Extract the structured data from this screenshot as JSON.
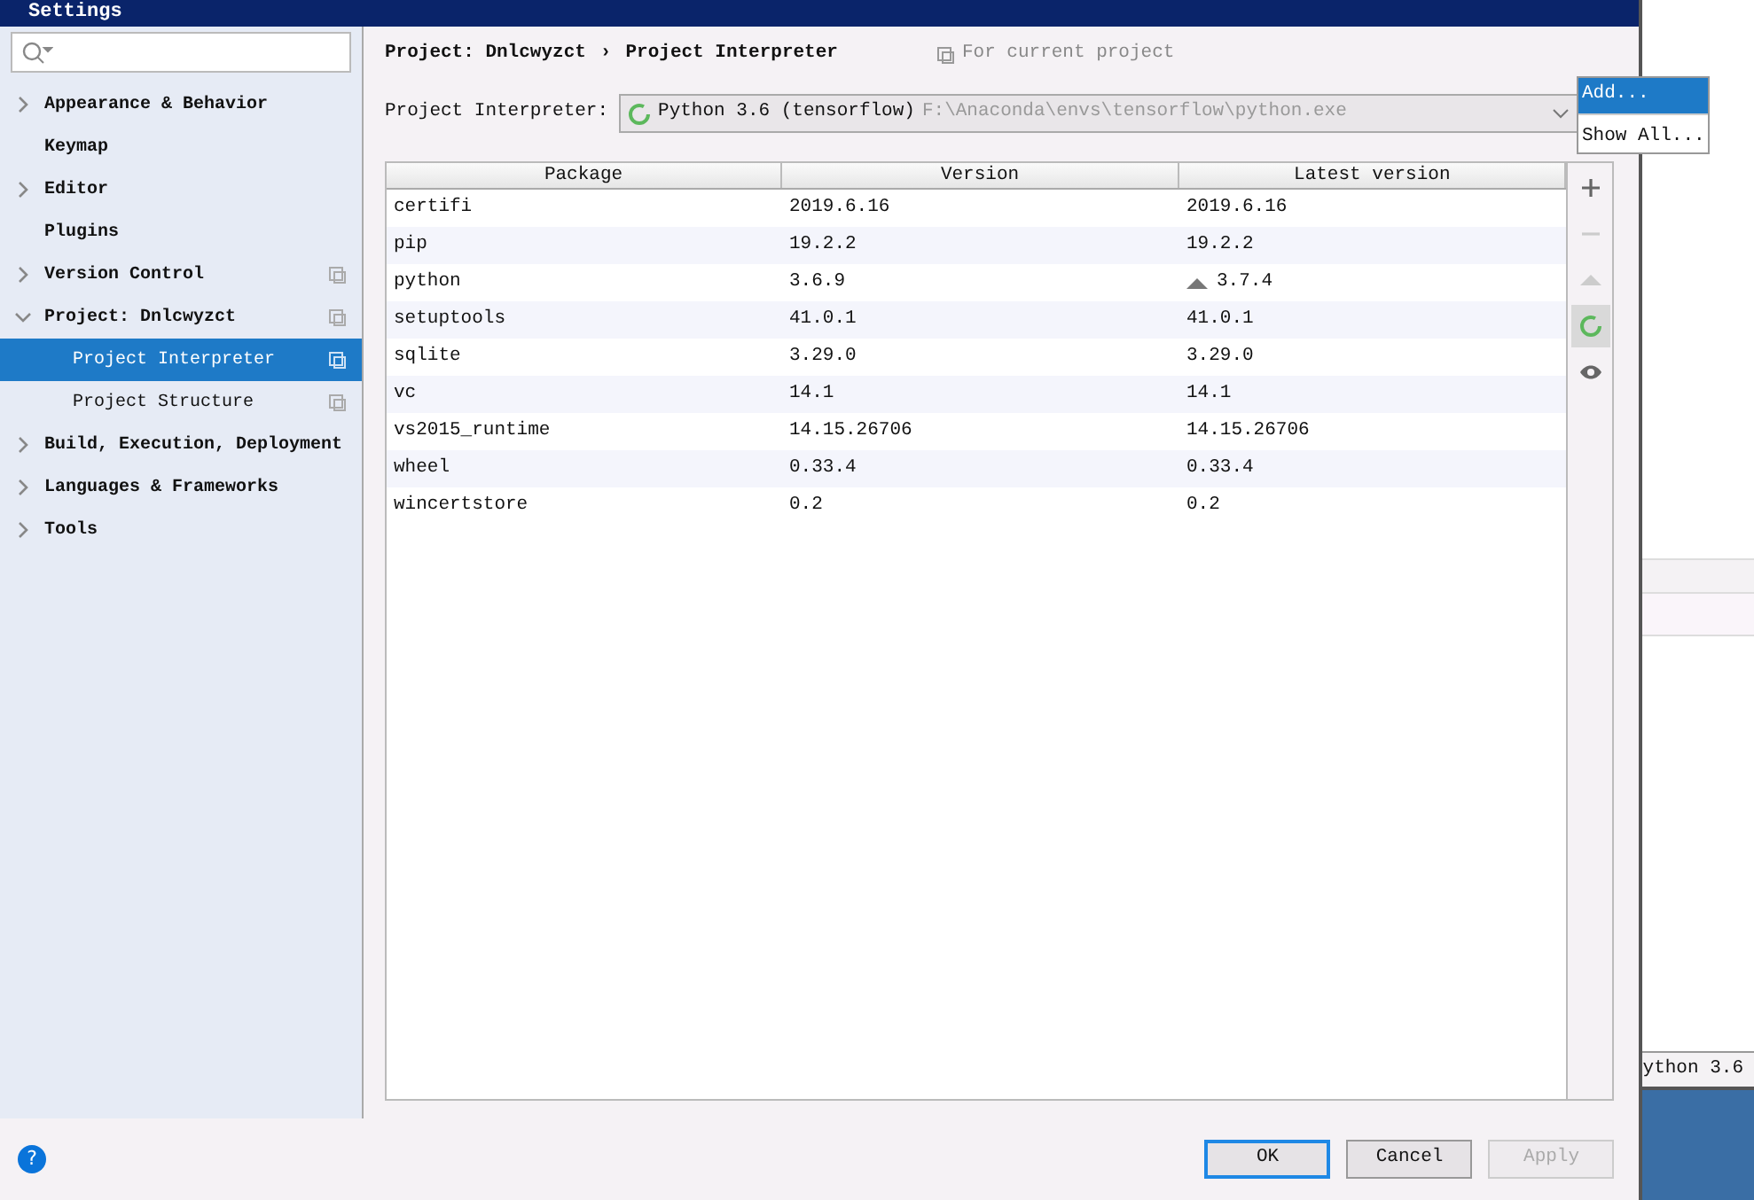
{
  "window": {
    "title": "Settings"
  },
  "sidebar": {
    "items": [
      {
        "label": "Appearance & Behavior",
        "kind": "group",
        "expanded": false,
        "selected": false,
        "scoped": false
      },
      {
        "label": "Keymap",
        "kind": "leaf",
        "selected": false,
        "scoped": false
      },
      {
        "label": "Editor",
        "kind": "group",
        "expanded": false,
        "selected": false,
        "scoped": false
      },
      {
        "label": "Plugins",
        "kind": "leaf",
        "selected": false,
        "scoped": false
      },
      {
        "label": "Version Control",
        "kind": "group",
        "expanded": false,
        "selected": false,
        "scoped": true
      },
      {
        "label": "Project: Dnlcwyzct",
        "kind": "group",
        "expanded": true,
        "selected": false,
        "scoped": true,
        "children": [
          {
            "label": "Project Interpreter",
            "kind": "leaf",
            "selected": true,
            "scoped": true
          },
          {
            "label": "Project Structure",
            "kind": "leaf",
            "selected": false,
            "scoped": true
          }
        ]
      },
      {
        "label": "Build, Execution, Deployment",
        "kind": "group",
        "expanded": false,
        "selected": false,
        "scoped": false
      },
      {
        "label": "Languages & Frameworks",
        "kind": "group",
        "expanded": false,
        "selected": false,
        "scoped": false
      },
      {
        "label": "Tools",
        "kind": "group",
        "expanded": false,
        "selected": false,
        "scoped": false
      }
    ]
  },
  "breadcrumb": {
    "items": [
      "Project: Dnlcwyzct",
      "Project Interpreter"
    ],
    "separator": "›",
    "scope_note": "For current project"
  },
  "interpreter": {
    "label": "Project Interpreter:",
    "name": "Python 3.6 (tensorflow)",
    "path": "F:\\Anaconda\\envs\\tensorflow\\python.exe"
  },
  "interpreter_menu": [
    {
      "label": "Add...",
      "selected": true
    },
    {
      "label": "Show All...",
      "selected": false
    }
  ],
  "table": {
    "columns": [
      "Package",
      "Version",
      "Latest version"
    ],
    "rows": [
      {
        "package": "certifi",
        "version": "2019.6.16",
        "latest": "2019.6.16",
        "upgrade": false
      },
      {
        "package": "pip",
        "version": "19.2.2",
        "latest": "19.2.2",
        "upgrade": false
      },
      {
        "package": "python",
        "version": "3.6.9",
        "latest": "3.7.4",
        "upgrade": true
      },
      {
        "package": "setuptools",
        "version": "41.0.1",
        "latest": "41.0.1",
        "upgrade": false
      },
      {
        "package": "sqlite",
        "version": "3.29.0",
        "latest": "3.29.0",
        "upgrade": false
      },
      {
        "package": "vc",
        "version": "14.1",
        "latest": "14.1",
        "upgrade": false
      },
      {
        "package": "vs2015_runtime",
        "version": "14.15.26706",
        "latest": "14.15.26706",
        "upgrade": false
      },
      {
        "package": "wheel",
        "version": "0.33.4",
        "latest": "0.33.4",
        "upgrade": false
      },
      {
        "package": "wincertstore",
        "version": "0.2",
        "latest": "0.2",
        "upgrade": false
      }
    ]
  },
  "table_toolbar": [
    {
      "kind": "add",
      "disabled": false,
      "selected": false
    },
    {
      "kind": "remove",
      "disabled": true,
      "selected": false
    },
    {
      "kind": "upgrade",
      "disabled": true,
      "selected": false
    },
    {
      "kind": "busy",
      "disabled": false,
      "selected": true
    },
    {
      "kind": "show",
      "disabled": false,
      "selected": false
    }
  ],
  "buttons": [
    {
      "label": "OK",
      "default": true,
      "disabled": false
    },
    {
      "label": "Cancel",
      "default": false,
      "disabled": false
    },
    {
      "label": "Apply",
      "default": false,
      "disabled": true
    }
  ],
  "help": {
    "label": "?"
  },
  "background_window": {
    "status_text": "ython 3.6"
  }
}
